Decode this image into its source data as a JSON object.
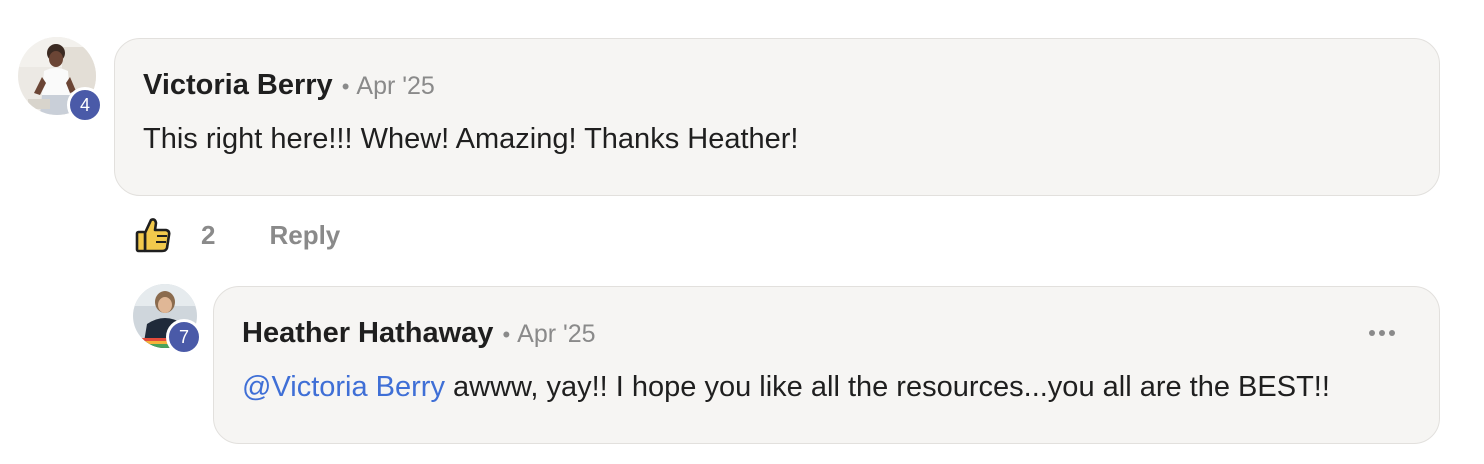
{
  "comment": {
    "author": "Victoria Berry",
    "separator": "•",
    "date": "Apr '25",
    "text": "This right here!!! Whew! Amazing! Thanks Heather!",
    "level": "4",
    "likes": "2",
    "reply_label": "Reply"
  },
  "reply": {
    "author": "Heather Hathaway",
    "separator": "•",
    "date": "Apr '25",
    "mention": "@Victoria Berry",
    "text": " awww, yay!! I hope you like all the resources...you all are the BEST!!",
    "level": "7",
    "more_icon": "ellipsis-horizontal"
  },
  "colors": {
    "bubble_bg": "#f6f5f3",
    "badge": "#4a5aa8",
    "mention": "#3f6fd6",
    "muted": "#8a8a8a"
  }
}
